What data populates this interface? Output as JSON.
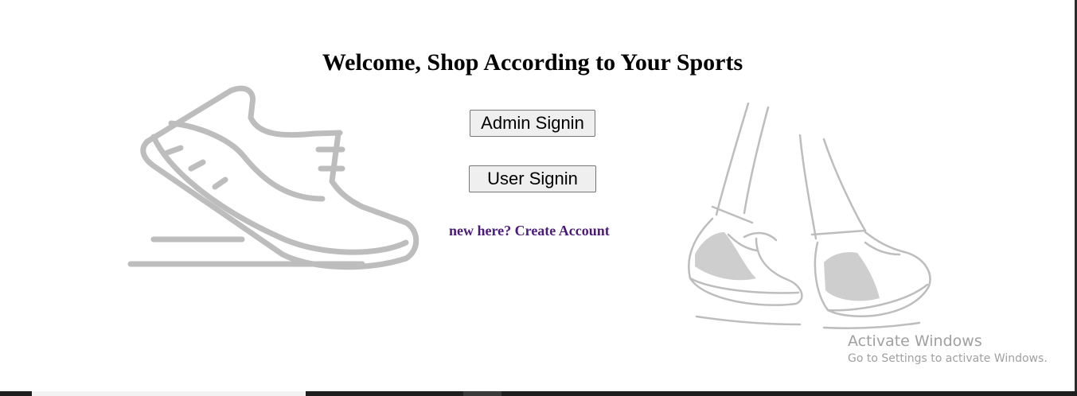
{
  "heading": "Welcome, Shop According to Your Sports",
  "buttons": {
    "admin_label": "Admin Signin",
    "user_label": "User Signin"
  },
  "create_account_link": "new here? Create Account",
  "images": {
    "left": "running-shoe-icon",
    "right": "walking-feet-sneakers-illustration"
  },
  "watermark": {
    "title": "Activate Windows",
    "subtitle": "Go to Settings to activate Windows."
  },
  "colors": {
    "link": "#4b1b7a",
    "illustration": "#bdbdbd",
    "watermark": "#a0a0a0"
  }
}
